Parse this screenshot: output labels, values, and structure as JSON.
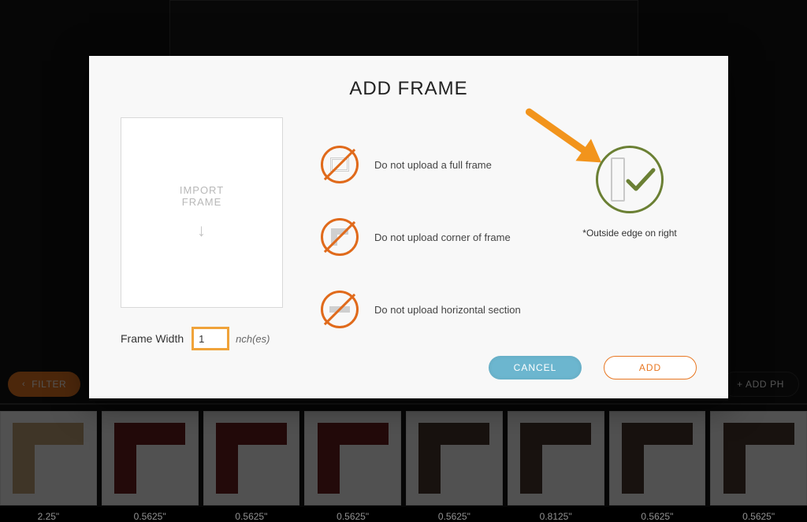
{
  "modal": {
    "title": "ADD FRAME",
    "import_box_line1": "IMPORT",
    "import_box_line2": "FRAME",
    "frame_width_label": "Frame Width",
    "frame_width_value": "1",
    "frame_width_unit": "nch(es)",
    "rules": [
      "Do not upload a full frame",
      "Do not upload corner of frame",
      "Do not upload horizontal section"
    ],
    "ok_note": "*Outside edge on right",
    "cancel_label": "CANCEL",
    "add_label": "ADD"
  },
  "background": {
    "filter_label": "FILTER",
    "add_ph_label": "+  ADD PH",
    "thumb_labels": [
      "2.25\"",
      "0.5625\"",
      "0.5625\"",
      "0.5625\"",
      "0.5625\"",
      "0.8125\"",
      "0.5625\"",
      "0.5625\""
    ]
  },
  "colors": {
    "accent": "#e87722",
    "ok": "#6b8034",
    "cancel": "#6cb6cf"
  }
}
